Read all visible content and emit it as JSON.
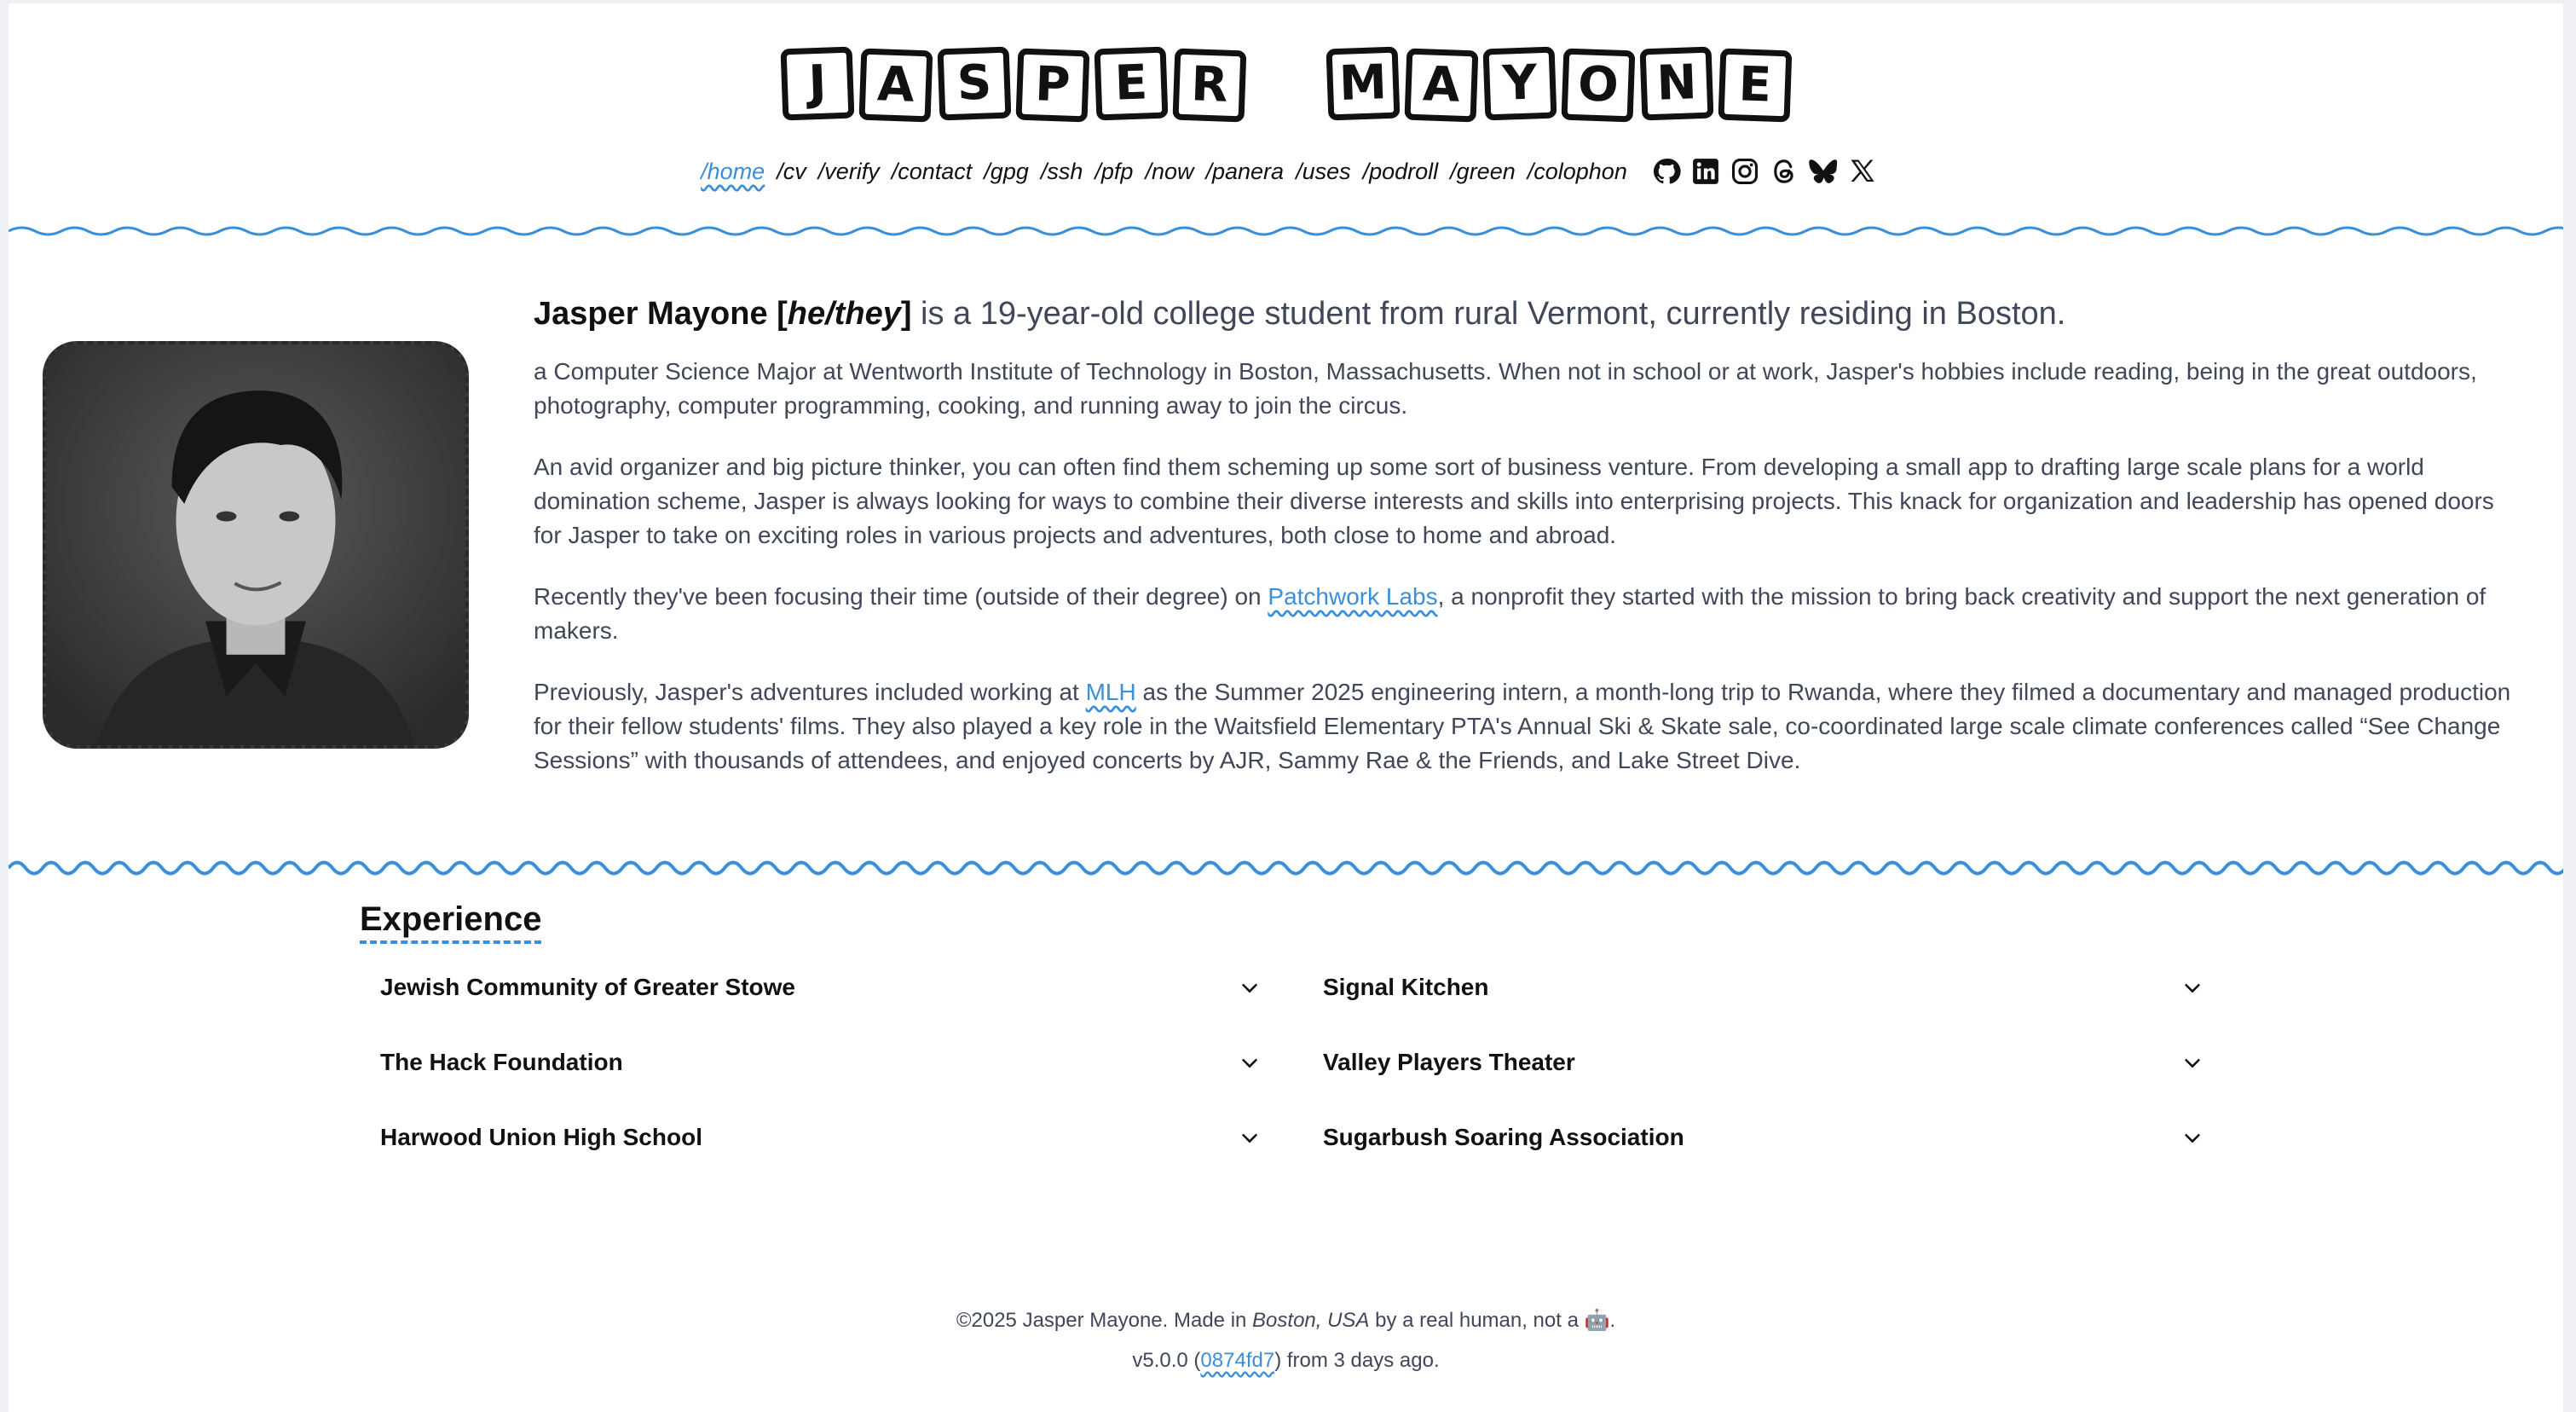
{
  "logo": {
    "first": [
      "J",
      "A",
      "S",
      "P",
      "E",
      "R"
    ],
    "last": [
      "M",
      "A",
      "Y",
      "O",
      "N",
      "E"
    ]
  },
  "nav": {
    "items": [
      "/home",
      "/cv",
      "/verify",
      "/contact",
      "/gpg",
      "/ssh",
      "/pfp",
      "/now",
      "/panera",
      "/uses",
      "/podroll",
      "/green",
      "/colophon"
    ],
    "active": "/home",
    "socials": [
      "github-icon",
      "linkedin-icon",
      "instagram-icon",
      "threads-icon",
      "bluesky-icon",
      "x-icon"
    ]
  },
  "bio": {
    "name": "Jasper Mayone",
    "bracket_open": " [",
    "pronouns": "he/they",
    "bracket_close": "]",
    "lead_rest": " is a 19-year-old college student from rural Vermont, currently residing in Boston.",
    "p1": "a Computer Science Major at Wentworth Institute of Technology in Boston, Massachusetts. When not in school or at work, Jasper's hobbies include reading, being in the great outdoors, photography, computer programming, cooking, and running away to join the circus.",
    "p2": "An avid organizer and big picture thinker, you can often find them scheming up some sort of business venture. From developing a small app to drafting large scale plans for a world domination scheme, Jasper is always looking for ways to combine their diverse interests and skills into enterprising projects. This knack for organization and leadership has opened doors for Jasper to take on exciting roles in various projects and adventures, both close to home and abroad.",
    "p3_before": "Recently they've been focusing their time (outside of their degree) on ",
    "p3_link": "Patchwork Labs",
    "p3_after": ", a nonprofit they started with the mission to bring back creativity and support the next generation of makers.",
    "p4_before": "Previously, Jasper's adventures included working at ",
    "p4_link": "MLH",
    "p4_after": " as the Summer 2025 engineering intern, a month-long trip to Rwanda, where they filmed a documentary and managed production for their fellow students' films. They also played a key role in the Waitsfield Elementary PTA's Annual Ski & Skate sale, co-coordinated large scale climate conferences called “See Change Sessions” with thousands of attendees, and enjoyed concerts by AJR, Sammy Rae & the Friends, and Lake Street Dive."
  },
  "experience": {
    "title": "Experience",
    "items": [
      "Jewish Community of Greater Stowe",
      "Signal Kitchen",
      "The Hack Foundation",
      "Valley Players Theater",
      "Harwood Union High School",
      "Sugarbush Soaring Association"
    ]
  },
  "footer": {
    "line1_before": "©2025 Jasper Mayone. Made in ",
    "line1_place": "Boston, USA",
    "line1_after": " by a real human, not a ",
    "robot": "🤖",
    "line1_end": ".",
    "line2_before": "v5.0.0 (",
    "commit": "0874fd7",
    "line2_after": ") from 3 days ago."
  },
  "colors": {
    "accent": "#3a8fd8",
    "text": "#3f4758",
    "heading": "#111111"
  }
}
